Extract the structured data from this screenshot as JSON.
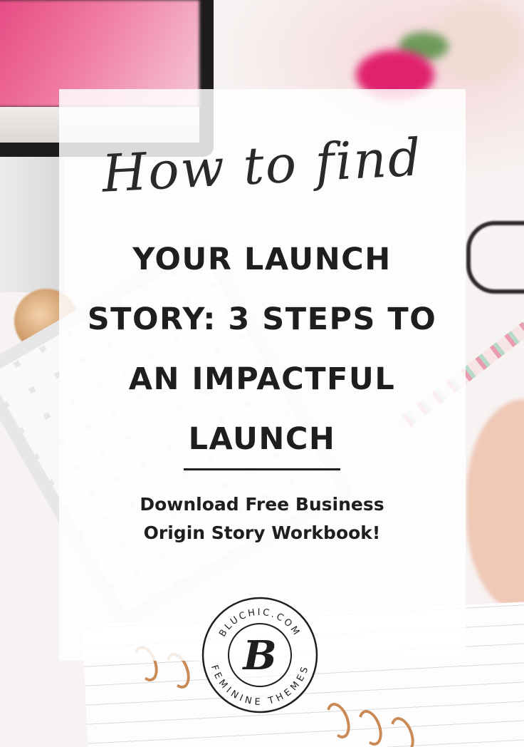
{
  "pin": {
    "script_heading": "How to find",
    "title_lines": [
      "YOUR LAUNCH",
      "STORY: 3 STEPS TO",
      "AN IMPACTFUL",
      "LAUNCH"
    ],
    "cta_lines": [
      "Download Free Business",
      "Origin Story Workbook!"
    ]
  },
  "logo": {
    "top_text": "BLUCHIC.COM",
    "monogram": "B",
    "bottom_text": "FEMININE THEMES"
  },
  "colors": {
    "text": "#1e1e1e",
    "card": "#ffffff",
    "accent_pink": "#e5467f",
    "copper": "#c98a55"
  }
}
